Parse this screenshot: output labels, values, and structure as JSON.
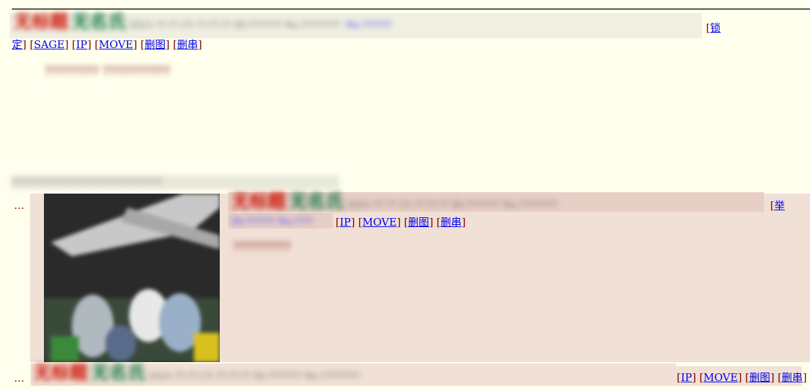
{
  "thread": {
    "op": {
      "title": "无标题",
      "name": "无名氏",
      "meta": "2021-??-?? (?) ??:??:?? ID:??????? No.????????",
      "lock_label_pre": "锁",
      "lock_label_post": "定",
      "actions": [
        "SAGE",
        "IP",
        "MOVE",
        "删图",
        "删串"
      ],
      "body_text": "???????? ??????????"
    },
    "omitted_text": "???????????????????????????????",
    "reply": {
      "title": "无标题",
      "name": "无名氏",
      "meta": "2021-??-?? (?) ??:??:?? ID:??????? No.????????",
      "report_label_pre": "举",
      "actions": [
        "IP",
        "MOVE",
        "删图",
        "删串"
      ],
      "body_text": "?????????"
    },
    "reply2": {
      "title": "无标题",
      "name": "无名氏",
      "meta": "2021-??-?? (?) ??:??:?? ID:??????? No.????????",
      "actions": [
        "IP",
        "MOVE",
        "删图",
        "删串"
      ]
    },
    "reply_marker": "…"
  }
}
